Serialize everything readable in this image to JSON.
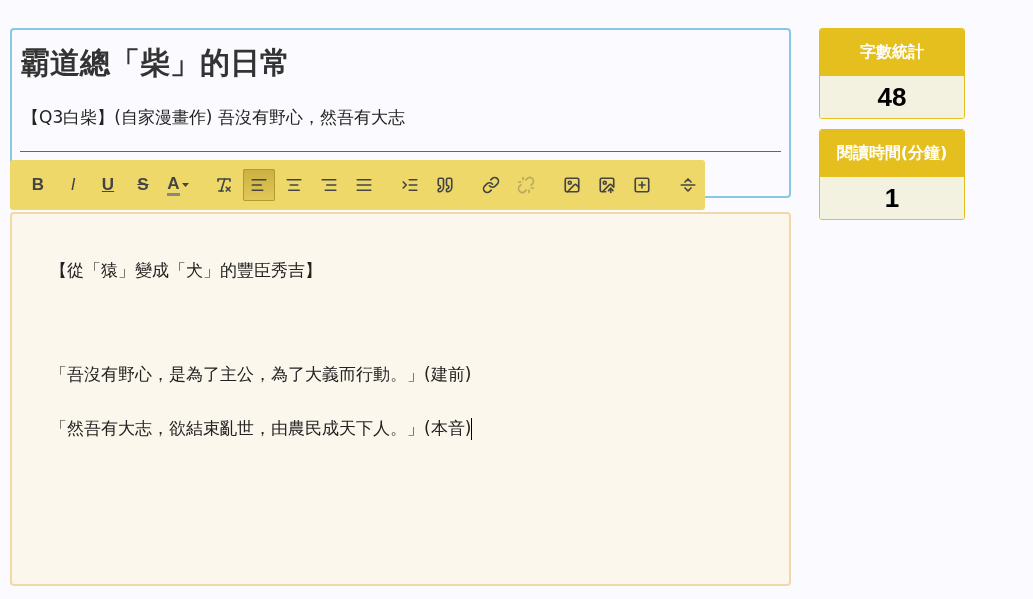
{
  "post": {
    "title": "霸道總「柴」的日常",
    "subtitle": "【Q3白柴】(自家漫畫作) 吾沒有野心，然吾有大志"
  },
  "toolbar": [
    {
      "kind": "text",
      "label": "B",
      "selected": false,
      "disabled": false
    },
    {
      "kind": "text",
      "label": "I",
      "selected": false,
      "disabled": false
    },
    {
      "kind": "text",
      "label": "U",
      "selected": false,
      "disabled": false
    },
    {
      "kind": "text",
      "label": "S",
      "selected": false,
      "disabled": false
    },
    {
      "kind": "color",
      "label": "A",
      "selected": false,
      "disabled": false
    },
    {
      "kind": "separator"
    },
    {
      "kind": "icon",
      "selected": false,
      "disabled": false
    },
    {
      "kind": "icon",
      "selected": true,
      "disabled": false
    },
    {
      "kind": "icon",
      "selected": false,
      "disabled": false
    },
    {
      "kind": "icon",
      "selected": false,
      "disabled": false
    },
    {
      "kind": "icon",
      "selected": false,
      "disabled": false
    },
    {
      "kind": "separator"
    },
    {
      "kind": "icon",
      "selected": false,
      "disabled": false
    },
    {
      "kind": "icon",
      "selected": false,
      "disabled": false
    },
    {
      "kind": "separator"
    },
    {
      "kind": "icon",
      "selected": false,
      "disabled": false
    },
    {
      "kind": "icon",
      "selected": false,
      "disabled": true
    },
    {
      "kind": "separator"
    },
    {
      "kind": "icon",
      "selected": false,
      "disabled": false
    },
    {
      "kind": "icon",
      "selected": false,
      "disabled": false
    },
    {
      "kind": "icon",
      "selected": false,
      "disabled": false
    },
    {
      "kind": "separator"
    },
    {
      "kind": "icon",
      "selected": false,
      "disabled": false
    }
  ],
  "editor": {
    "cursor_at_end": true,
    "paragraphs": [
      "【從「猿」變成「犬」的豐臣秀吉】",
      "「吾沒有野心，是為了主公，為了大義而行動。」(建前)",
      "「然吾有大志，欲結束亂世，由農民成天下人。」(本音)"
    ]
  },
  "stats": [
    {
      "label": "字數統計",
      "value": "48"
    },
    {
      "label": "閱讀時間(分鐘)",
      "value": "1"
    }
  ]
}
